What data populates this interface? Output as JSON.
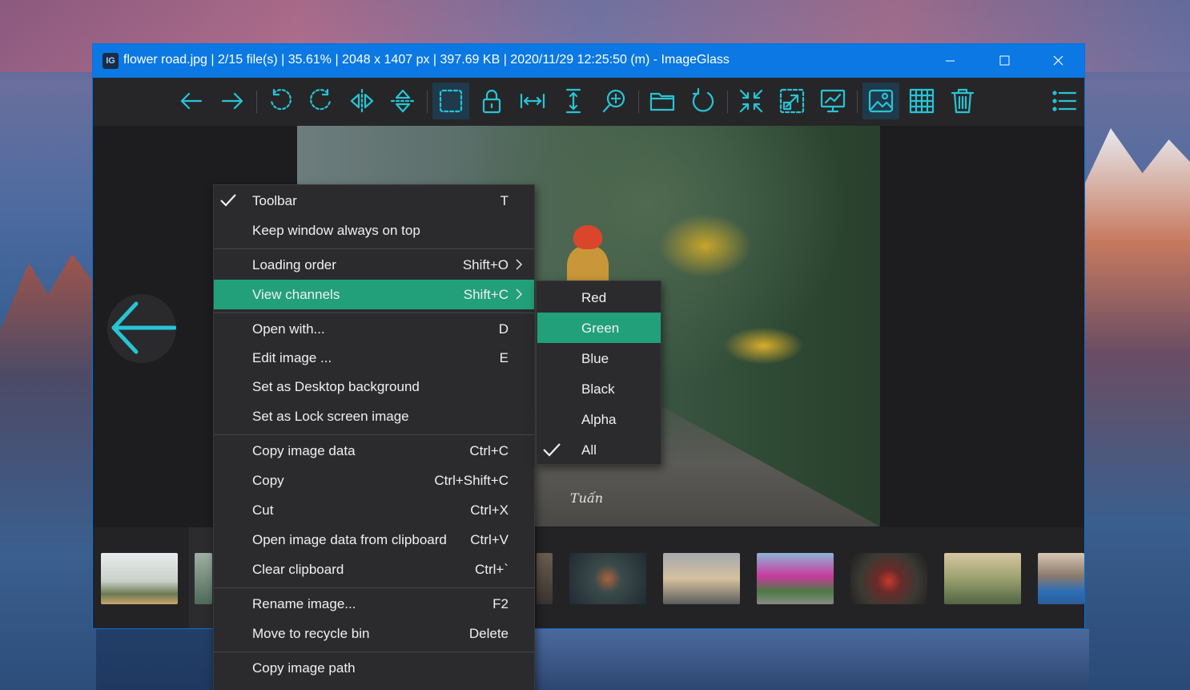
{
  "window": {
    "title": "flower road.jpg  |  2/15 file(s)  |  35.61%  |  2048 x 1407 px  |  397.69 KB  |  2020/11/29 12:25:50 (m)  - ImageGlass",
    "app_icon_text": "IG"
  },
  "toolbar": {
    "accent_color": "#27c4d6",
    "buttons": [
      {
        "name": "previous-image",
        "icon": "arrow-left-icon"
      },
      {
        "name": "next-image",
        "icon": "arrow-right-icon"
      },
      {
        "name": "rotate-left",
        "icon": "rotate-left-icon"
      },
      {
        "name": "rotate-right",
        "icon": "rotate-right-icon"
      },
      {
        "name": "flip-horizontal",
        "icon": "flip-horizontal-icon"
      },
      {
        "name": "flip-vertical",
        "icon": "flip-vertical-icon"
      },
      {
        "name": "selection",
        "icon": "selection-icon",
        "active": true
      },
      {
        "name": "lock-zoom",
        "icon": "lock-icon"
      },
      {
        "name": "scale-to-width",
        "icon": "scale-width-icon"
      },
      {
        "name": "scale-to-height",
        "icon": "scale-height-icon"
      },
      {
        "name": "zoom",
        "icon": "zoom-icon"
      },
      {
        "name": "open-file",
        "icon": "folder-icon"
      },
      {
        "name": "refresh",
        "icon": "refresh-icon"
      },
      {
        "name": "auto-zoom",
        "icon": "auto-zoom-icon"
      },
      {
        "name": "scale-to-fit",
        "icon": "scale-to-fit-icon"
      },
      {
        "name": "slideshow",
        "icon": "slideshow-icon"
      },
      {
        "name": "thumbnail-bar",
        "icon": "image-icon",
        "active": true
      },
      {
        "name": "checkerboard",
        "icon": "grid-icon"
      },
      {
        "name": "delete",
        "icon": "trash-icon"
      },
      {
        "name": "main-menu",
        "icon": "menu-list-icon"
      }
    ]
  },
  "photo": {
    "signature": "Tuấn"
  },
  "context_menu": {
    "highlight_color": "#22a07a",
    "items": [
      {
        "label": "Toolbar",
        "shortcut": "T",
        "checked": true
      },
      {
        "label": "Keep window always on top",
        "shortcut": ""
      },
      {
        "label": "Loading order",
        "shortcut": "Shift+O",
        "submenu": true
      },
      {
        "label": "View channels",
        "shortcut": "Shift+C",
        "submenu": true,
        "highlighted": true
      },
      {
        "label": "Open with...",
        "shortcut": "D"
      },
      {
        "label": "Edit image ...",
        "shortcut": "E"
      },
      {
        "label": "Set as Desktop background",
        "shortcut": ""
      },
      {
        "label": "Set as Lock screen image",
        "shortcut": ""
      },
      {
        "label": "Copy image data",
        "shortcut": "Ctrl+C"
      },
      {
        "label": "Copy",
        "shortcut": "Ctrl+Shift+C"
      },
      {
        "label": "Cut",
        "shortcut": "Ctrl+X"
      },
      {
        "label": "Open image data from clipboard",
        "shortcut": "Ctrl+V"
      },
      {
        "label": "Clear clipboard",
        "shortcut": "Ctrl+`"
      },
      {
        "label": "Rename image...",
        "shortcut": "F2"
      },
      {
        "label": "Move to recycle bin",
        "shortcut": "Delete"
      },
      {
        "label": "Copy image path",
        "shortcut": ""
      }
    ]
  },
  "channels_submenu": {
    "items": [
      {
        "label": "Red"
      },
      {
        "label": "Green",
        "highlighted": true
      },
      {
        "label": "Blue"
      },
      {
        "label": "Black"
      },
      {
        "label": "Alpha"
      },
      {
        "label": "All",
        "checked": true
      }
    ]
  }
}
